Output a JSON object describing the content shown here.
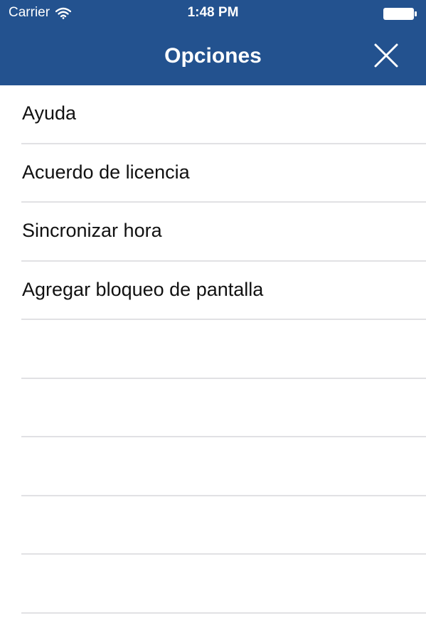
{
  "status_bar": {
    "carrier": "Carrier",
    "time": "1:48 PM",
    "icons": [
      "wifi-icon",
      "battery-icon"
    ]
  },
  "nav": {
    "title": "Opciones",
    "close_icon": "close-icon"
  },
  "menu": {
    "items": [
      {
        "label": "Ayuda"
      },
      {
        "label": "Acuerdo de licencia"
      },
      {
        "label": "Sincronizar hora"
      },
      {
        "label": "Agregar bloqueo de pantalla"
      }
    ],
    "empty_rows": 6
  },
  "colors": {
    "nav_background": "#23528f",
    "nav_text": "#ffffff",
    "row_separator": "#e1e1e4",
    "row_text": "#111111",
    "background": "#ffffff"
  }
}
